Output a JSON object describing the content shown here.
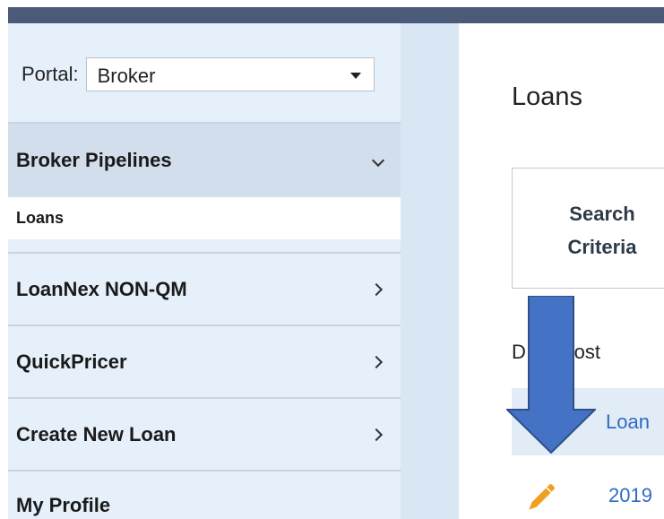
{
  "sidebar": {
    "portal": {
      "label": "Portal:",
      "selected": "Broker"
    },
    "sections": [
      {
        "label": "Broker Pipelines",
        "expanded": true
      },
      {
        "label": "LoanNex NON-QM",
        "expanded": false
      },
      {
        "label": "QuickPricer",
        "expanded": false
      },
      {
        "label": "Create New Loan",
        "expanded": false
      },
      {
        "label": "My Profile",
        "expanded": false
      }
    ],
    "broker_pipelines_items": [
      {
        "label": "Loans"
      }
    ]
  },
  "main": {
    "title": "Loans",
    "search_criteria": {
      "line1": "Search",
      "line2": "Criteria"
    },
    "display_text": "D     ay most",
    "table": {
      "header_label": "Loan",
      "rows": [
        {
          "loan_number": "2019"
        }
      ]
    }
  },
  "colors": {
    "top_bar": "#4a5a78",
    "sidebar_bg": "#e6f0fb",
    "section_active": "#d2deec",
    "link": "#2f6bc2",
    "arrow": "#4472c4",
    "edit_icon": "#f0a020"
  },
  "icons": {
    "portal_select": "dropdown-caret-icon",
    "expanded_section": "chevron-down-icon",
    "collapsed_section": "chevron-right-icon",
    "row_action": "pencil-icon",
    "overlay": "down-arrow-icon"
  }
}
